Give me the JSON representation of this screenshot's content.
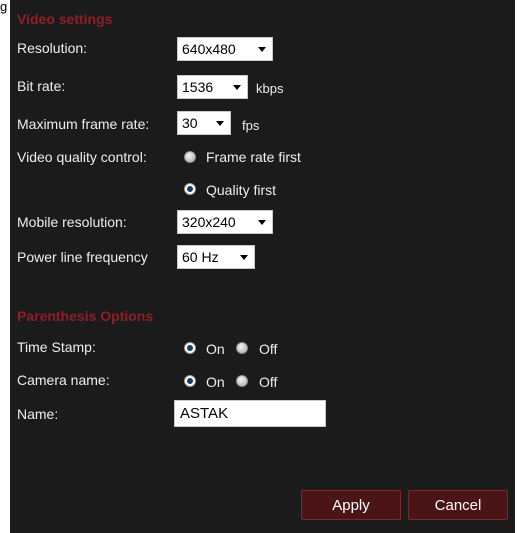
{
  "video_settings": {
    "title": "Video settings",
    "resolution": {
      "label": "Resolution:",
      "value": "640x480"
    },
    "bit_rate": {
      "label": "Bit rate:",
      "value": "1536",
      "unit": "kbps"
    },
    "max_frame_rate": {
      "label": "Maximum frame rate:",
      "value": "30",
      "unit": "fps"
    },
    "quality_control": {
      "label": "Video quality control:",
      "options": [
        {
          "label": "Frame rate first",
          "checked": false
        },
        {
          "label": "Quality first",
          "checked": true
        }
      ]
    },
    "mobile_resolution": {
      "label": "Mobile resolution:",
      "value": "320x240"
    },
    "power_line_frequency": {
      "label": "Power line frequency",
      "value": "60 Hz"
    }
  },
  "parenthesis_options": {
    "title": "Parenthesis Options",
    "time_stamp": {
      "label": "Time Stamp:",
      "on": "On",
      "off": "Off",
      "selected": "On"
    },
    "camera_name": {
      "label": "Camera name:",
      "on": "On",
      "off": "Off",
      "selected": "On"
    },
    "name": {
      "label": "Name:",
      "value": "ASTAK"
    }
  },
  "buttons": {
    "apply": "Apply",
    "cancel": "Cancel"
  },
  "colors": {
    "panel_bg": "#1b1b1b",
    "section_title": "#8c2026",
    "button_bg": "#4b1416"
  }
}
